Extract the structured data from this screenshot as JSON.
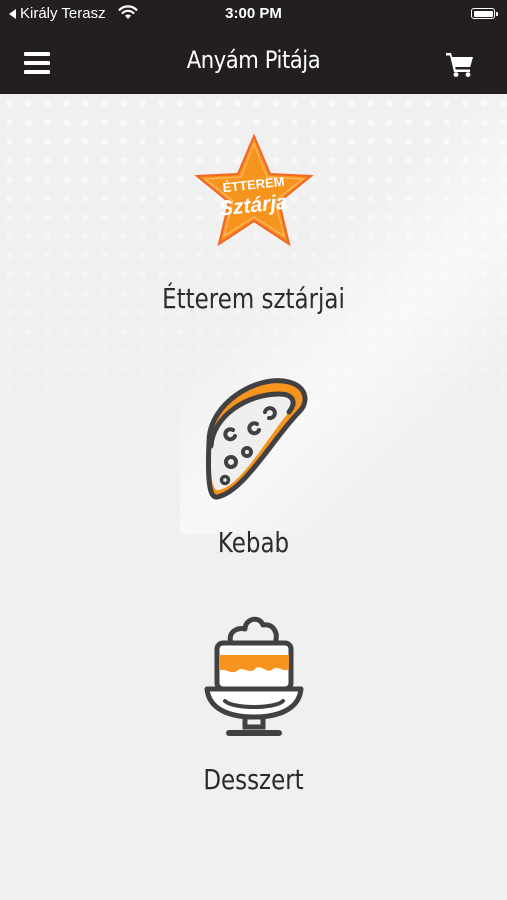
{
  "status_bar": {
    "back_app": "Király Terasz",
    "time": "3:00 PM"
  },
  "nav": {
    "title": "Anyám Pitája",
    "menu_icon": "hamburger-menu-icon",
    "cart_icon": "shopping-cart-icon"
  },
  "categories": [
    {
      "label": "Étterem sztárjai",
      "icon": "restaurant-star-badge-icon",
      "badge_line1": "ÉTTEREM",
      "badge_line2": "Sztárja"
    },
    {
      "label": "Kebab",
      "icon": "kebab-wrap-icon"
    },
    {
      "label": "Desszert",
      "icon": "dessert-cup-icon"
    }
  ],
  "colors": {
    "header_bg": "#231f20",
    "accent_orange": "#f7941d",
    "icon_stroke": "#414042",
    "content_bg": "#f0f0f0"
  }
}
